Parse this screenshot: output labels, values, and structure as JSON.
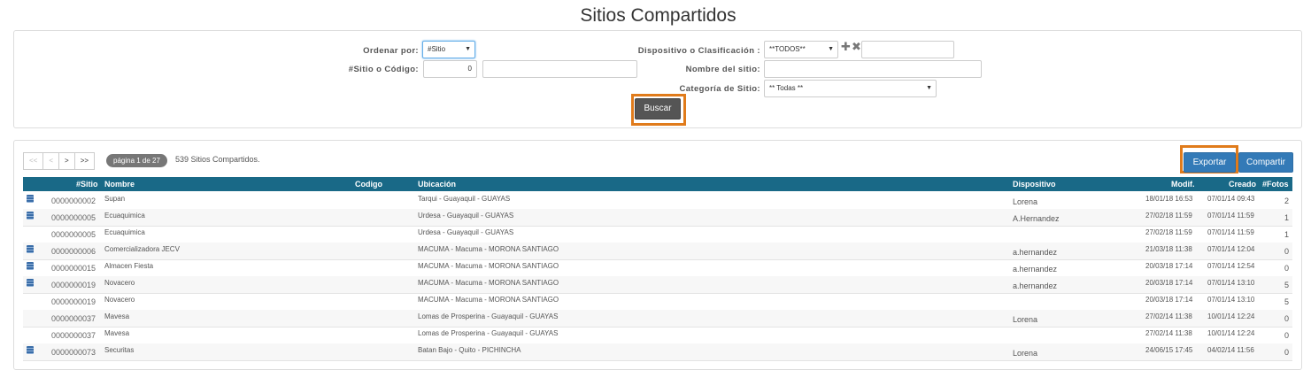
{
  "page_title": "Sitios Compartidos",
  "search": {
    "ordenar_label": "Ordenar por:",
    "ordenar_value": "#Sitio",
    "sitio_codigo_label": "#Sitio o Código:",
    "sitio_codigo_value": "0",
    "codigo_extra_value": "",
    "dispositivo_label": "Dispositivo o Clasificación :",
    "dispositivo_value": "**TODOS**",
    "dispositivo_extra_value": "",
    "nombre_label": "Nombre del sitio:",
    "nombre_value": "",
    "categoria_label": "Categoría de Sitio:",
    "categoria_value": "** Todas **",
    "buscar_label": "Buscar"
  },
  "pager": {
    "first": "<<",
    "prev": "<",
    "next": ">",
    "last": ">>",
    "page_text": "página 1 de 27",
    "count_text": "539 Sitios Compartidos."
  },
  "actions": {
    "exportar_label": "Exportar",
    "compartir_label": "Compartir"
  },
  "table": {
    "headers": {
      "sitio": "#Sitio",
      "nombre": "Nombre",
      "codigo": "Codigo",
      "ubicacion": "Ubicación",
      "dispositivo": "Dispositivo",
      "modif": "Modif.",
      "creado": "Creado",
      "fotos": "#Fotos"
    },
    "rows": [
      {
        "icon": true,
        "sitio": "0000000002",
        "nombre": "Supan",
        "ubicacion": "Tarqui - Guayaquil - GUAYAS",
        "dispositivo": "Lorena",
        "modif": "18/01/18 16:53",
        "creado": "07/01/14 09:43",
        "fotos": "2"
      },
      {
        "icon": true,
        "sitio": "0000000005",
        "nombre": "Ecuaquimica",
        "ubicacion": "Urdesa - Guayaquil - GUAYAS",
        "dispositivo": "A.Hernandez",
        "modif": "27/02/18 11:59",
        "creado": "07/01/14 11:59",
        "fotos": "1"
      },
      {
        "icon": false,
        "sitio": "0000000005",
        "nombre": "Ecuaquimica",
        "ubicacion": "Urdesa - Guayaquil - GUAYAS",
        "dispositivo": "",
        "modif": "27/02/18 11:59",
        "creado": "07/01/14 11:59",
        "fotos": "1"
      },
      {
        "icon": true,
        "sitio": "0000000006",
        "nombre": "Comercializadora JECV",
        "ubicacion": "MACUMA - Macuma - MORONA SANTIAGO",
        "dispositivo": "a.hernandez",
        "modif": "21/03/18 11:38",
        "creado": "07/01/14 12:04",
        "fotos": "0"
      },
      {
        "icon": true,
        "sitio": "0000000015",
        "nombre": "Almacen Fiesta",
        "ubicacion": "MACUMA - Macuma - MORONA SANTIAGO",
        "dispositivo": "a.hernandez",
        "modif": "20/03/18 17:14",
        "creado": "07/01/14 12:54",
        "fotos": "0"
      },
      {
        "icon": true,
        "sitio": "0000000019",
        "nombre": "Novacero",
        "ubicacion": "MACUMA - Macuma - MORONA SANTIAGO",
        "dispositivo": "a.hernandez",
        "modif": "20/03/18 17:14",
        "creado": "07/01/14 13:10",
        "fotos": "5"
      },
      {
        "icon": false,
        "sitio": "0000000019",
        "nombre": "Novacero",
        "ubicacion": "MACUMA - Macuma - MORONA SANTIAGO",
        "dispositivo": "",
        "modif": "20/03/18 17:14",
        "creado": "07/01/14 13:10",
        "fotos": "5"
      },
      {
        "icon": false,
        "sitio": "0000000037",
        "nombre": "Mavesa",
        "ubicacion": "Lomas de Prosperina - Guayaquil - GUAYAS",
        "dispositivo": "Lorena",
        "modif": "27/02/14 11:38",
        "creado": "10/01/14 12:24",
        "fotos": "0"
      },
      {
        "icon": false,
        "sitio": "0000000037",
        "nombre": "Mavesa",
        "ubicacion": "Lomas de Prosperina - Guayaquil - GUAYAS",
        "dispositivo": "",
        "modif": "27/02/14 11:38",
        "creado": "10/01/14 12:24",
        "fotos": "0"
      },
      {
        "icon": true,
        "sitio": "0000000073",
        "nombre": "Securitas",
        "ubicacion": "Batan Bajo - Quito - PICHINCHA",
        "dispositivo": "Lorena",
        "modif": "24/06/15 17:45",
        "creado": "04/02/14 11:56",
        "fotos": "0"
      }
    ]
  },
  "colors": {
    "header_bg": "#196987",
    "highlight": "#e07b1b",
    "primary": "#337ab7"
  }
}
